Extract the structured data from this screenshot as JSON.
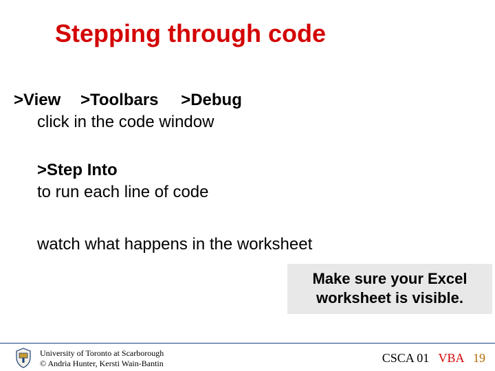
{
  "title": "Stepping through code",
  "menu": {
    "view": ">View",
    "toolbars": ">Toolbars",
    "debug": ">Debug"
  },
  "body": {
    "click_line": "click in the code window",
    "step_into": ">Step Into",
    "run_line": "to run each line of code",
    "watch_line": "watch what happens in the worksheet"
  },
  "callout": "Make sure your Excel worksheet is visible.",
  "footer": {
    "line1": "University of Toronto at Scarborough",
    "line2": "© Andria Hunter, Kersti Wain-Bantin",
    "course": "CSCA 01",
    "vba": "VBA",
    "page": "19"
  }
}
